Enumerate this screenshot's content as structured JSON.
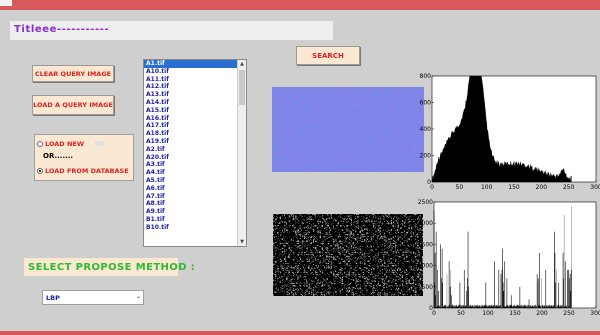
{
  "title": "Titleee-----------",
  "buttons": {
    "clear": "CLEAR QUERY IMAGE",
    "load": "LOAD A QUERY IMAGE",
    "search": "SEARCH"
  },
  "radio": {
    "load_new": "LOAD NEW",
    "or": "OR.......",
    "load_db": "LOAD FROM DATABASE",
    "selected": "LOAD FROM DATABASE"
  },
  "files": [
    "A1.tif",
    "A10.tif",
    "A11.tif",
    "A12.tif",
    "A13.tif",
    "A14.tif",
    "A15.tif",
    "A16.tif",
    "A17.tif",
    "A18.tif",
    "A19.tif",
    "A2.tif",
    "A20.tif",
    "A3.tif",
    "A4.tif",
    "A5.tif",
    "A6.tif",
    "A7.tif",
    "A8.tif",
    "A9.tif",
    "B1.tif",
    "B10.tif"
  ],
  "selected_file": "A1.tif",
  "method_label": "SELECT PROPOSE METHOD :",
  "method": {
    "selected": "LBP"
  },
  "histogram1": {
    "x_ticks": [
      "0",
      "50",
      "100",
      "150",
      "200",
      "250",
      "300"
    ],
    "y_ticks": [
      "0",
      "200",
      "400",
      "600",
      "800"
    ],
    "xlim": [
      0,
      300
    ],
    "ylim": [
      0,
      800
    ]
  },
  "histogram2": {
    "x_ticks": [
      "0",
      "50",
      "100",
      "150",
      "200",
      "250",
      "300"
    ],
    "y_ticks": [
      "0",
      "500",
      "1000",
      "1500",
      "2000",
      "2500"
    ],
    "xlim": [
      0,
      300
    ],
    "ylim": [
      0,
      2500
    ]
  },
  "colors": {
    "accent": "#d9585b",
    "button_bg": "#fbe8d3",
    "button_text": "#e02020",
    "title_text": "#8a2bd0",
    "method_text": "#2dbb2d",
    "list_text": "#1a1aa0",
    "list_select": "#2a6fd0"
  }
}
